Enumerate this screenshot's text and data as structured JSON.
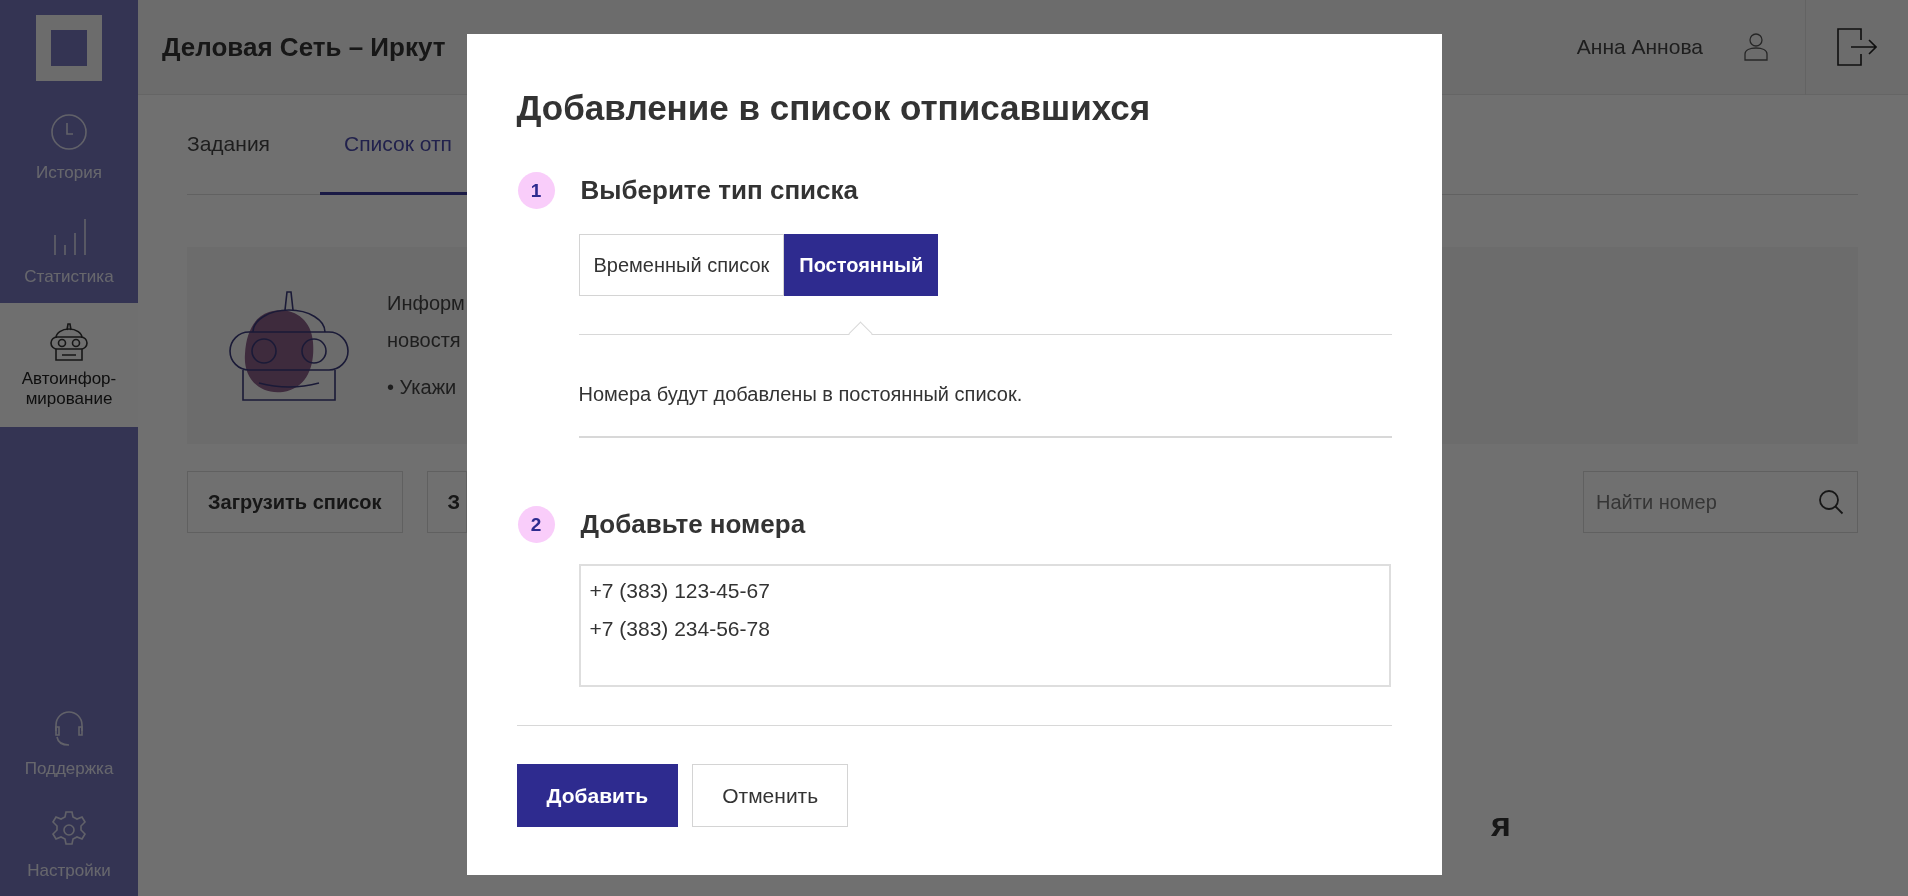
{
  "sidebar": {
    "items": [
      {
        "label": "История",
        "selected": false
      },
      {
        "label": "Статистика",
        "selected": false
      },
      {
        "label": "Автоинфор-\nмирование",
        "selected": true
      }
    ],
    "bottom_items": [
      {
        "label": "Поддержка",
        "selected": false
      },
      {
        "label": "Настройки",
        "selected": false
      }
    ]
  },
  "header": {
    "title": "Деловая Сеть – Иркут",
    "user_name": "Анна Аннова"
  },
  "tabs": [
    {
      "label": "Задания",
      "selected": false
    },
    {
      "label": "Список отп",
      "selected": true
    }
  ],
  "info_panel": {
    "lines": [
      "Информ",
      "новостя",
      "• Укажи"
    ]
  },
  "toolbar": {
    "buttons": [
      "Загрузить список",
      "З"
    ],
    "search": {
      "placeholder": "Найти номер"
    }
  },
  "empty_state": {
    "title": "я"
  },
  "dialog": {
    "title": "Добавление в список отписавшихся",
    "steps": [
      {
        "number": "1",
        "title": "Выберите тип списка",
        "list_types": [
          {
            "label": "Временный список",
            "selected": false
          },
          {
            "label": "Постоянный",
            "selected": true
          }
        ],
        "description": "Номера будут добавлены в постоянный список."
      },
      {
        "number": "2",
        "title": "Добавьте номера",
        "numbers_field": {
          "value": "+7 (383) 123-45-67\n+7 (383) 234-56-78"
        }
      }
    ],
    "buttons": [
      {
        "label": "Добавить",
        "kind": "primary"
      },
      {
        "label": "Отменить",
        "kind": "secondary"
      }
    ]
  }
}
